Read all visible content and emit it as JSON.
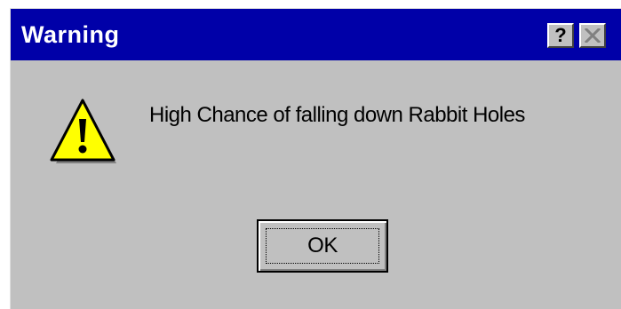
{
  "dialog": {
    "title": "Warning",
    "help_label": "?",
    "message": "High Chance of falling down Rabbit Holes",
    "icon": "warning-triangle-icon",
    "ok_label": "OK"
  },
  "colors": {
    "titlebar": "#0000a8",
    "title_text": "#ffffff",
    "window_face": "#c0c0c0",
    "warning_yellow": "#ffff00"
  }
}
